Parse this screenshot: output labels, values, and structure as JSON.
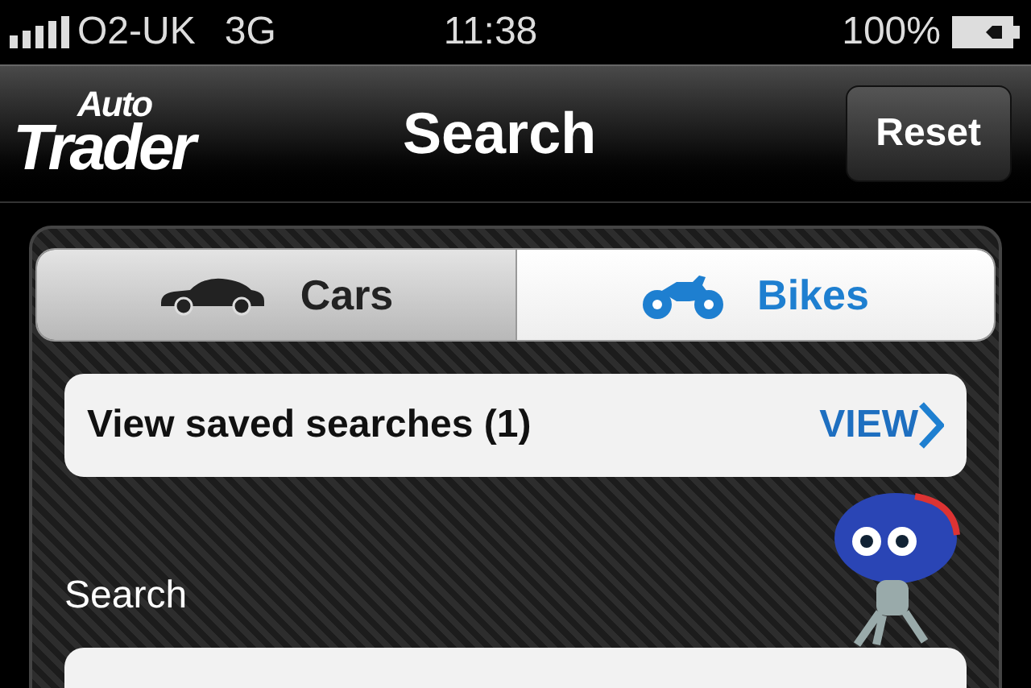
{
  "status_bar": {
    "carrier": "O2-UK",
    "network": "3G",
    "time": "11:38",
    "battery": "100%"
  },
  "nav_bar": {
    "logo": {
      "line_1": "Auto",
      "line_2": "Trader"
    },
    "title": "Search",
    "button": "Reset"
  },
  "tabs": [
    {
      "label": "Cars",
      "kind": "car",
      "selected": false
    },
    {
      "label": "Bikes",
      "kind": "bike",
      "selected": true
    }
  ],
  "saved_searches": {
    "label": "View saved searches (1)",
    "action": "VIEW"
  },
  "search": {
    "label": "Search"
  }
}
